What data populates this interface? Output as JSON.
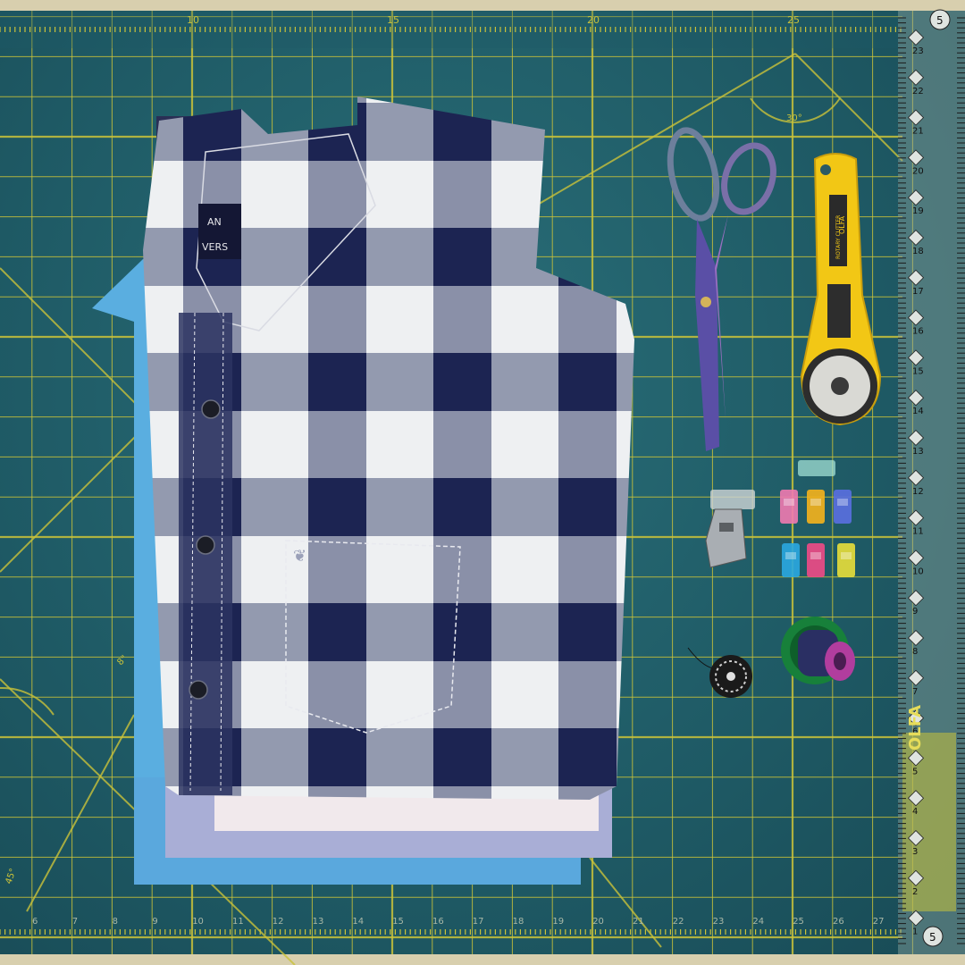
{
  "mat": {
    "top_ruler": [
      "10",
      "15",
      "20",
      "25"
    ],
    "bottom_ruler": [
      "6",
      "7",
      "8",
      "9",
      "10",
      "11",
      "12",
      "13",
      "14",
      "15",
      "16",
      "17",
      "18",
      "19",
      "20",
      "21",
      "22",
      "23",
      "24",
      "25",
      "26",
      "27"
    ],
    "angle_marks": [
      "30°",
      "45°",
      "8\""
    ],
    "colors": {
      "mat": "#1f5b66",
      "grid": "#c9c23a",
      "ruler": "#a9b8a7"
    }
  },
  "side_ruler": {
    "numbers": [
      "23",
      "22",
      "21",
      "20",
      "19",
      "18",
      "17",
      "16",
      "15",
      "14",
      "13",
      "12",
      "11",
      "10",
      "9",
      "8",
      "7",
      "6",
      "5",
      "4",
      "3",
      "2",
      "1"
    ],
    "top_badge": "5",
    "bottom_badge": "5",
    "brand": "OLFA"
  },
  "shirt": {
    "label_line1": "AN",
    "label_line2": "VERS",
    "colors": {
      "navy": "#1c2452",
      "white": "#eef0f2",
      "grey": "#8a90a8",
      "blue": "#5aaee0"
    }
  },
  "cutter": {
    "brand": "OLFA",
    "label": "ROTARY CUTTER",
    "color": "#f2c715"
  },
  "icons": [
    "scissors-icon",
    "rotary-cutter-icon",
    "presser-foot-icon",
    "wonder-clip-icon",
    "bobbin-icon",
    "thread-spool-icon"
  ]
}
